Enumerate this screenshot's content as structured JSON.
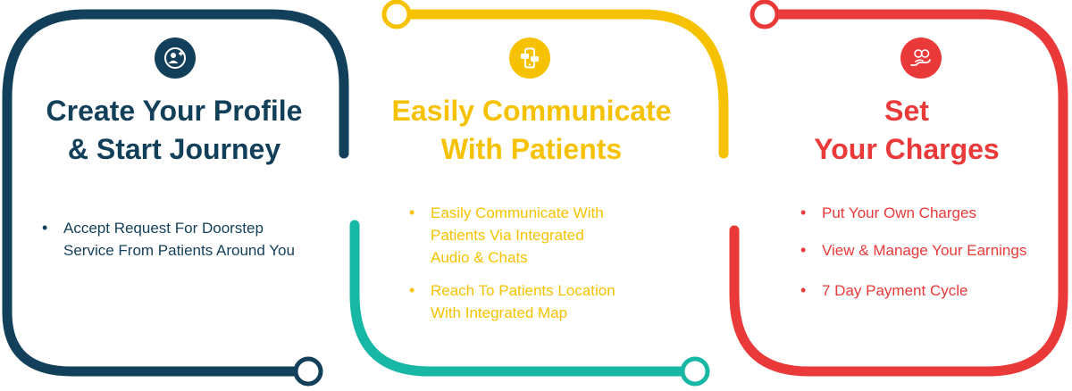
{
  "colors": {
    "navy": "#123f59",
    "yellow": "#f6c200",
    "teal": "#17b7a5",
    "red": "#ea3939"
  },
  "cards": [
    {
      "icon": "add-user-icon",
      "title_lines": [
        "Create Your Profile",
        "& Start Journey"
      ],
      "bullets": [
        {
          "lines": [
            "Accept Request For Doorstep",
            "Service From Patients Around You"
          ]
        }
      ]
    },
    {
      "icon": "phone-chat-icon",
      "title_lines": [
        "Easily Communicate",
        "With Patients"
      ],
      "bullets": [
        {
          "lines": [
            "Easily Communicate With",
            "Patients Via Integrated",
            "Audio & Chats"
          ]
        },
        {
          "lines": [
            "Reach To Patients Location",
            "With Integrated Map"
          ]
        }
      ]
    },
    {
      "icon": "hand-money-icon",
      "title_lines": [
        "Set",
        "Your Charges"
      ],
      "bullets": [
        {
          "lines": [
            "Put Your Own Charges"
          ]
        },
        {
          "lines": [
            "View & Manage Your Earnings"
          ]
        },
        {
          "lines": [
            "7 Day Payment Cycle"
          ]
        }
      ]
    }
  ]
}
